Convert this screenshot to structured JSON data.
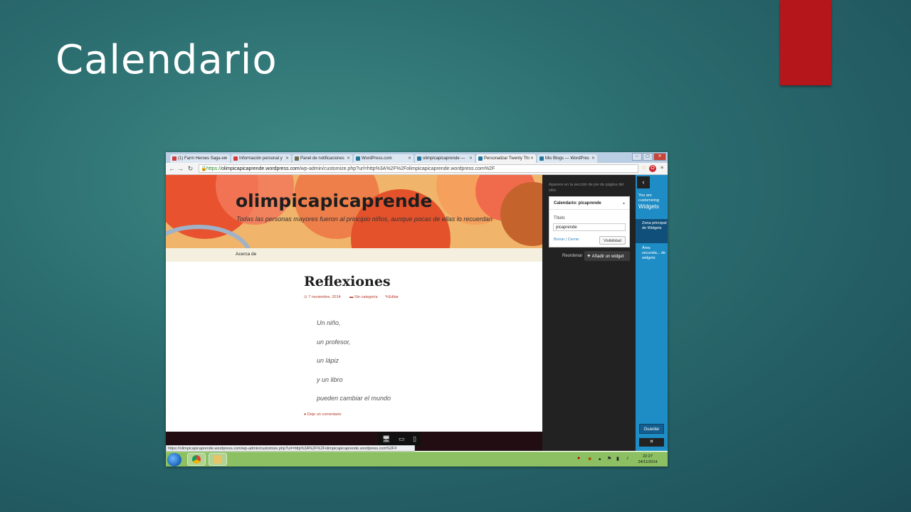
{
  "slide": {
    "title": "Calendario"
  },
  "browser": {
    "tabs": [
      {
        "label": "(1) Farm Heroes Saga en",
        "favicon_color": "#d43a3a"
      },
      {
        "label": "Información personal y",
        "favicon_color": "#d43a3a"
      },
      {
        "label": "Panel de notificaciones",
        "favicon_color": "#6d6d4a"
      },
      {
        "label": "WordPress.com",
        "favicon_color": "#21759b"
      },
      {
        "label": "olimpicapicaprende — ",
        "favicon_color": "#21759b"
      },
      {
        "label": "Personalizar Twenty Thi",
        "favicon_color": "#21759b"
      },
      {
        "label": "Mis Blogs — WordPres",
        "favicon_color": "#21759b"
      }
    ],
    "url": {
      "scheme": "https://",
      "domain": "olimpicapicaprende.wordpress.com",
      "path": "/wp-admin/customize.php?url=http%3A%2F%2Folimpicapicaprende.wordpress.com%2F"
    },
    "status_url": "https://olimpicapicaprende.wordpress.com/wp-admin/customize.php?url=http%3A%2F%2Folimpicapicaprende.wordpress.com%2F#"
  },
  "site": {
    "title": "olimpicapicaprende",
    "description": "Todas las personas mayores fueron al principio niños, aunque pocas de ellas lo recuerdan",
    "nav_item": "Acerca de",
    "post": {
      "title": "Reflexiones",
      "date": "7 noviembre, 2014",
      "category": "Sin categoría",
      "edit": "Editar",
      "verses": [
        "Un niño,",
        "un profesor,",
        "un lápiz",
        "y un libro",
        "pueden cambiar el mundo"
      ],
      "comment_link": "Deje un comentario"
    }
  },
  "customizer": {
    "note": "Aparece en la sección de pie de página del sitio.",
    "widget": {
      "header": "Calendario: picaprende",
      "label": "Título:",
      "value": "picaprende",
      "delete": "Borrar",
      "separator": "|",
      "close": "Cerrar",
      "visibility": "Visibilidad"
    },
    "reorder": "Reordenar",
    "add_widget": "Añadir un widget"
  },
  "sidebar": {
    "heading_line1": "You are",
    "heading_line2": "customizing",
    "heading_line3": "Widgets",
    "items": [
      {
        "label": "Zona principal de Widgets",
        "active": true
      },
      {
        "label": "Área secunda... de widgets",
        "active": false
      }
    ],
    "save": "Guardar",
    "close": "✕"
  },
  "taskbar": {
    "time": "22:27",
    "date": "24/11/2014"
  }
}
